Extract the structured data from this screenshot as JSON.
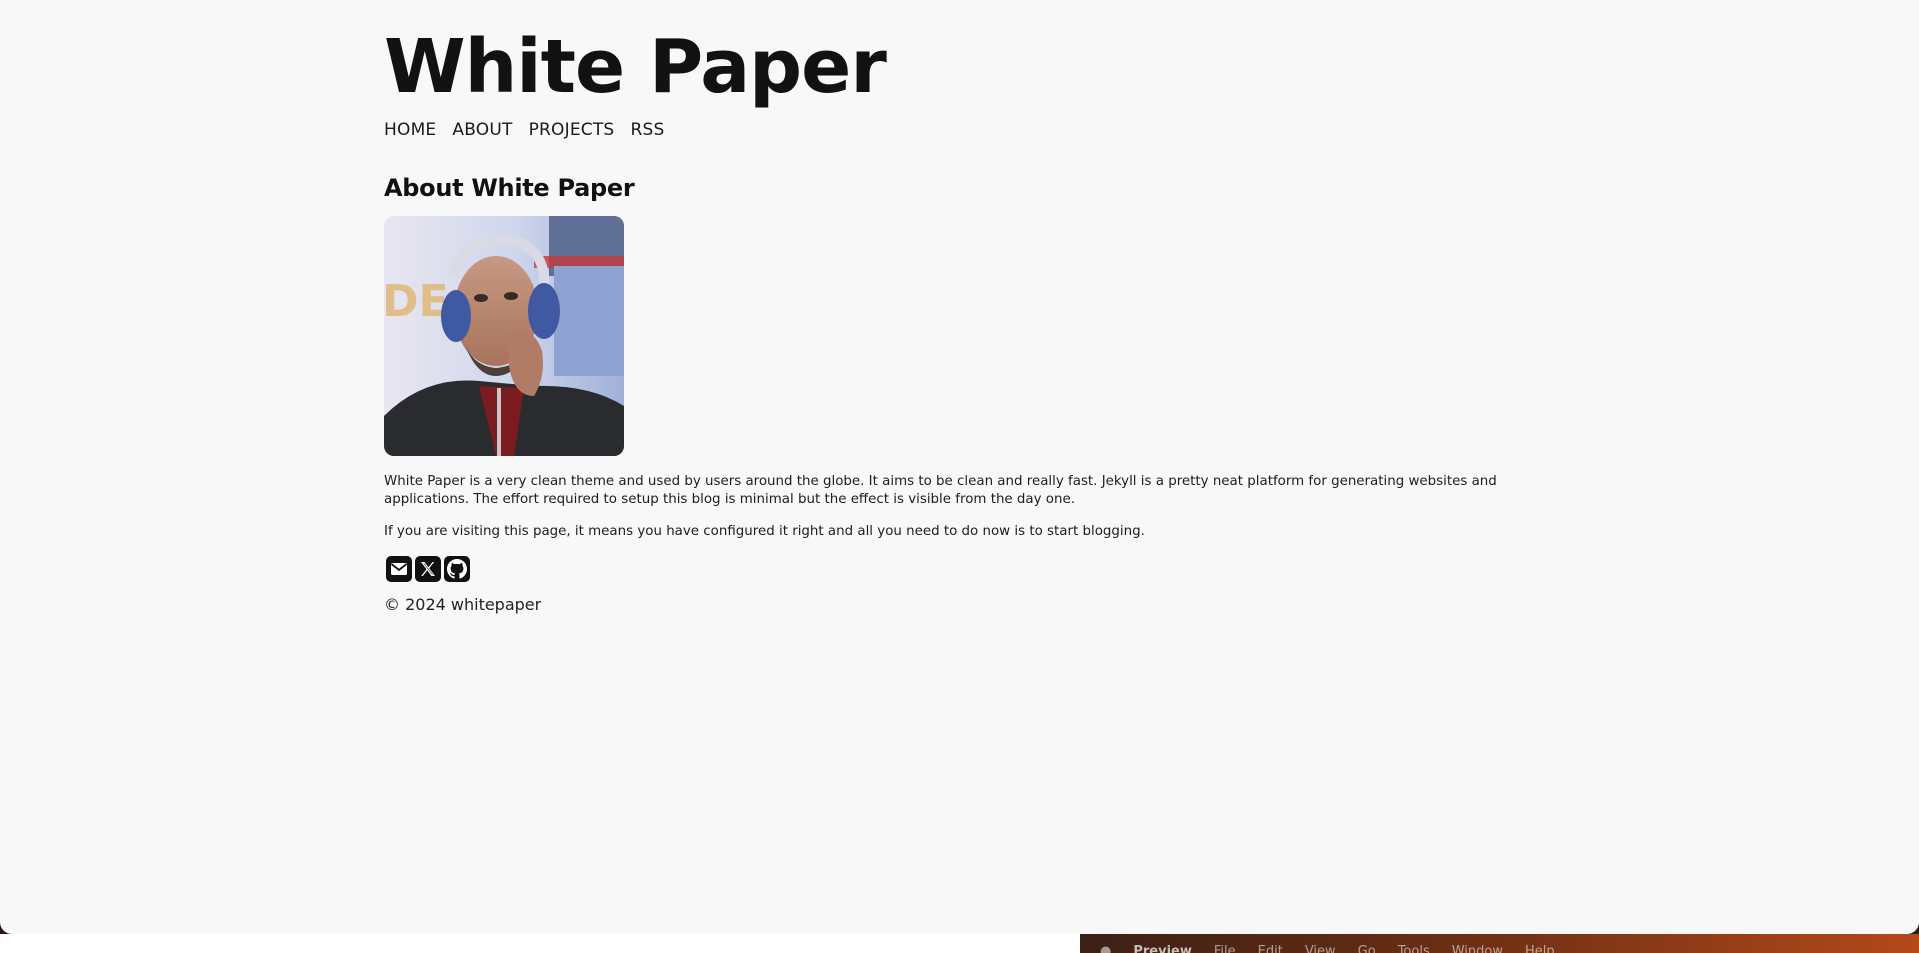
{
  "site": {
    "title": "White Paper"
  },
  "nav": {
    "items": [
      {
        "label": "HOME"
      },
      {
        "label": "ABOUT"
      },
      {
        "label": "PROJECTS"
      },
      {
        "label": "RSS"
      }
    ]
  },
  "page": {
    "heading": "About White Paper",
    "paragraphs": [
      "White Paper is a very clean theme and used by users around the globe. It aims to be clean and really fast. Jekyll is a pretty neat platform for generating websites and applications. The effort required to setup this blog is minimal but the effect is visible from the day one.",
      "If you are visiting this page, it means you have configured it right and all you need to do now is to start blogging."
    ]
  },
  "social": {
    "icons": [
      "email-icon",
      "x-icon",
      "github-icon"
    ]
  },
  "footer": {
    "copyright": "© 2024 whitepaper"
  },
  "menubar": {
    "app_name": "Preview",
    "items": [
      "File",
      "Edit",
      "View",
      "Go",
      "Tools",
      "Window",
      "Help"
    ]
  },
  "colors": {
    "background": "#f8f8f8",
    "text": "#111111",
    "icon_bg": "#111111"
  }
}
